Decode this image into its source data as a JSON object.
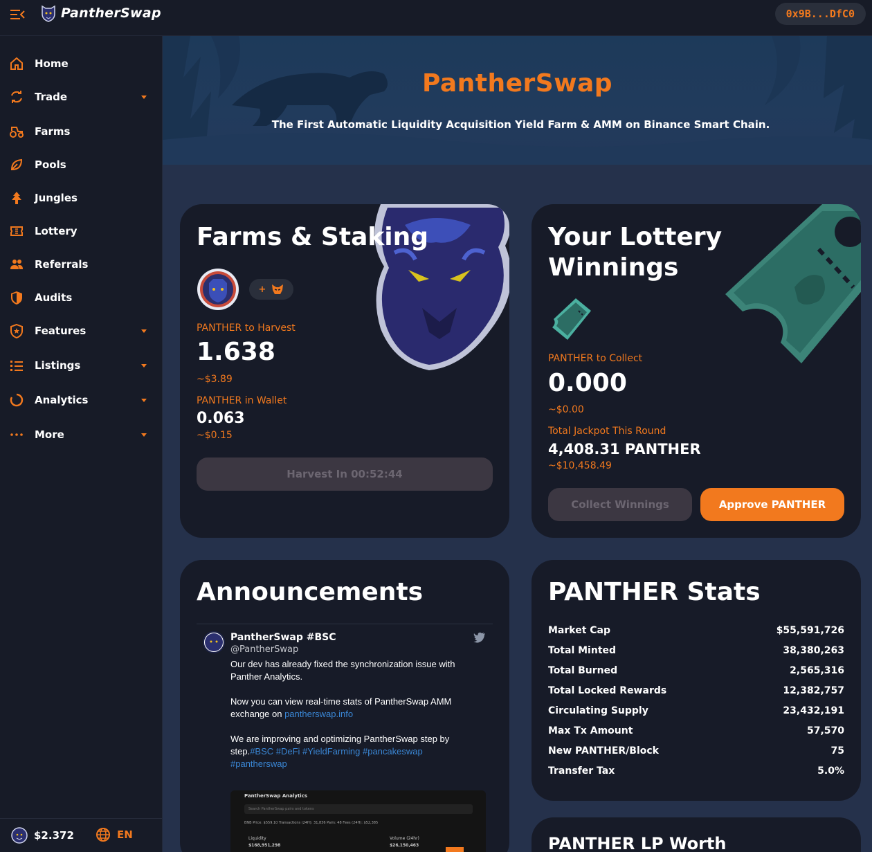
{
  "header": {
    "brand": "PantherSwap",
    "wallet_address": "0x9B...DfC0"
  },
  "sidebar": {
    "items": [
      {
        "label": "Home",
        "icon": "home-icon",
        "has_submenu": false
      },
      {
        "label": "Trade",
        "icon": "swap-icon",
        "has_submenu": true
      },
      {
        "label": "Farms",
        "icon": "tractor-icon",
        "has_submenu": false
      },
      {
        "label": "Pools",
        "icon": "leaf-icon",
        "has_submenu": false
      },
      {
        "label": "Jungles",
        "icon": "tree-icon",
        "has_submenu": false
      },
      {
        "label": "Lottery",
        "icon": "ticket-icon",
        "has_submenu": false
      },
      {
        "label": "Referrals",
        "icon": "people-icon",
        "has_submenu": false
      },
      {
        "label": "Audits",
        "icon": "shield-icon",
        "has_submenu": false
      },
      {
        "label": "Features",
        "icon": "shield-star-icon",
        "has_submenu": true
      },
      {
        "label": "Listings",
        "icon": "list-icon",
        "has_submenu": true
      },
      {
        "label": "Analytics",
        "icon": "ring-icon",
        "has_submenu": true
      },
      {
        "label": "More",
        "icon": "dots-icon",
        "has_submenu": true
      }
    ],
    "price": "$2.372",
    "language": "EN"
  },
  "hero": {
    "title": "PantherSwap",
    "subtitle": "The First Automatic Liquidity Acquisition Yield Farm & AMM on Binance Smart Chain."
  },
  "farms": {
    "title": "Farms & Staking",
    "add_token_label": "+",
    "harvest_label": "PANTHER to Harvest",
    "harvest_value": "1.638",
    "harvest_usd": "~$3.89",
    "wallet_label": "PANTHER in Wallet",
    "wallet_value": "0.063",
    "wallet_usd": "~$0.15",
    "harvest_button": "Harvest In 00:52:44"
  },
  "lottery": {
    "title_line1": "Your Lottery",
    "title_line2": "Winnings",
    "collect_label": "PANTHER to Collect",
    "collect_value": "0.000",
    "collect_usd": "~$0.00",
    "jackpot_label": "Total Jackpot This Round",
    "jackpot_value": "4,408.31 PANTHER",
    "jackpot_usd": "~$10,458.49",
    "collect_button": "Collect Winnings",
    "approve_button": "Approve PANTHER"
  },
  "announcements": {
    "title": "Announcements",
    "tweet": {
      "name": "PantherSwap #BSC",
      "handle": "@PantherSwap",
      "p1": "Our dev has already fixed the synchronization issue with Panther Analytics.",
      "p2_text": "Now you can view real-time stats of PantherSwap AMM exchange on ",
      "p2_link": "pantherswap.info",
      "p3_text": "We are improving and optimizing PantherSwap step by step.",
      "p3_tags": "#BSC #DeFi #YieldFarming #pancakeswap #pantherswap",
      "media_title": "PantherSwap Analytics",
      "media_search": "Search PantherSwap pairs and tokens",
      "media_row": "BNB Price: $559.10    Transactions (24H): 31,836    Pairs: 48    Fees (24H): $52,385",
      "media_liq_label": "Liquidity",
      "media_liq_value": "$168,951,298",
      "media_vol_label": "Volume (24hr)",
      "media_vol_value": "$26,150,463"
    }
  },
  "stats": {
    "title": "PANTHER Stats",
    "rows": [
      {
        "label": "Market Cap",
        "value": "$55,591,726"
      },
      {
        "label": "Total Minted",
        "value": "38,380,263"
      },
      {
        "label": "Total Burned",
        "value": "2,565,316"
      },
      {
        "label": "Total Locked Rewards",
        "value": "12,382,757"
      },
      {
        "label": "Circulating Supply",
        "value": "23,432,191"
      },
      {
        "label": "Max Tx Amount",
        "value": "57,570"
      },
      {
        "label": "New PANTHER/Block",
        "value": "75"
      },
      {
        "label": "Transfer Tax",
        "value": "5.0%"
      }
    ]
  },
  "lp_worth": {
    "title": "PANTHER LP Worth"
  },
  "colors": {
    "accent": "#f2791e",
    "card_bg": "#171b28",
    "page_bg": "#25314b",
    "sidebar_bg": "#171b27",
    "disabled_btn": "#3c3742",
    "link": "#3a86d4"
  }
}
